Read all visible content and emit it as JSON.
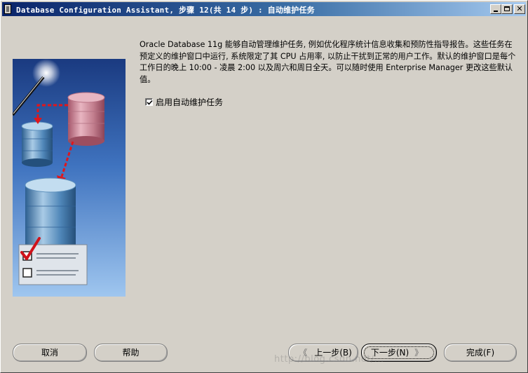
{
  "window": {
    "title": "Database Configuration Assistant, 步骤 12(共 14 步) : 自动维护任务",
    "controls": {
      "minimize": "_",
      "maximize": "□",
      "close": "×"
    }
  },
  "content": {
    "description": "Oracle Database 11g 能够自动管理维护任务, 例如优化程序统计信息收集和预防性指导报告。这些任务在预定义的维护窗口中运行, 系统限定了其 CPU 占用率, 以防止干扰到正常的用户工作。默认的维护窗口是每个工作日的晚上 10:00 - 凌晨 2:00 以及周六和周日全天。可以随时使用 Enterprise Manager 更改这些默认值。",
    "enable_auto_maintenance": {
      "label": "启用自动维护任务",
      "checked": true
    }
  },
  "buttons": {
    "cancel": "取消",
    "help": "帮助",
    "back": "上一步(B)",
    "next": "下一步(N)",
    "finish": "完成(F)"
  },
  "icons": {
    "back_arrow": "chevron-left-icon",
    "next_arrow": "chevron-right-icon"
  },
  "watermark": "http://blog.csdn.net/...",
  "colors": {
    "dialog_bg": "#d4d0c8",
    "titlebar_start": "#0a246a",
    "titlebar_end": "#a6caf0",
    "illustration_bg_top": "#1a3a80",
    "illustration_bg_bottom": "#9fc6ef",
    "arrow_red": "#e0161b"
  }
}
